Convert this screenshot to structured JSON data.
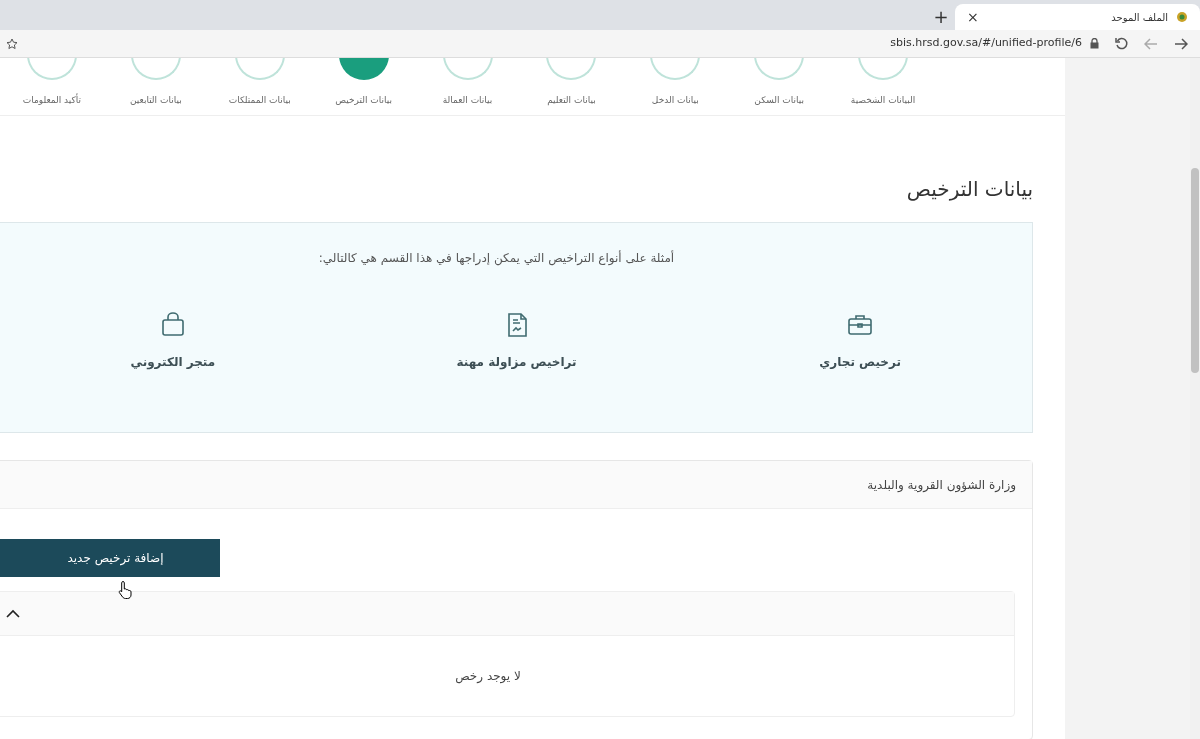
{
  "browser": {
    "tab_title": "الملف الموحد",
    "tab_close": "×",
    "new_tab": "+",
    "url": "sbis.hrsd.gov.sa/#/unified-profile/6"
  },
  "steps": [
    {
      "label": "البيانات الشخصية",
      "selected": false
    },
    {
      "label": "بيانات السكن",
      "selected": false
    },
    {
      "label": "بيانات الدخل",
      "selected": false
    },
    {
      "label": "بيانات التعليم",
      "selected": false
    },
    {
      "label": "بيانات العمالة",
      "selected": false
    },
    {
      "label": "بيانات الترخيص",
      "selected": true
    },
    {
      "label": "بيانات الممتلكات",
      "selected": false
    },
    {
      "label": "بيانات التابعين",
      "selected": false
    },
    {
      "label": "تأكيد المعلومات",
      "selected": false
    }
  ],
  "section": {
    "title": "بيانات الترخيص"
  },
  "info": {
    "text": "أمثلة على أنواع التراخيص التي يمكن إدراجها في هذا القسم هي كالتالي:",
    "examples": [
      {
        "label": "ترخيص تجاري",
        "kind": "briefcase"
      },
      {
        "label": "تراخيص مزاولة مهنة",
        "kind": "document"
      },
      {
        "label": "متجر الكتروني",
        "kind": "bag"
      }
    ]
  },
  "card": {
    "title": "وزارة الشؤون القروية والبلدية",
    "add_button": "إضافة ترخيص جديد",
    "accordion": {
      "expanded": true,
      "empty_text": "لا يوجد رخص"
    }
  }
}
